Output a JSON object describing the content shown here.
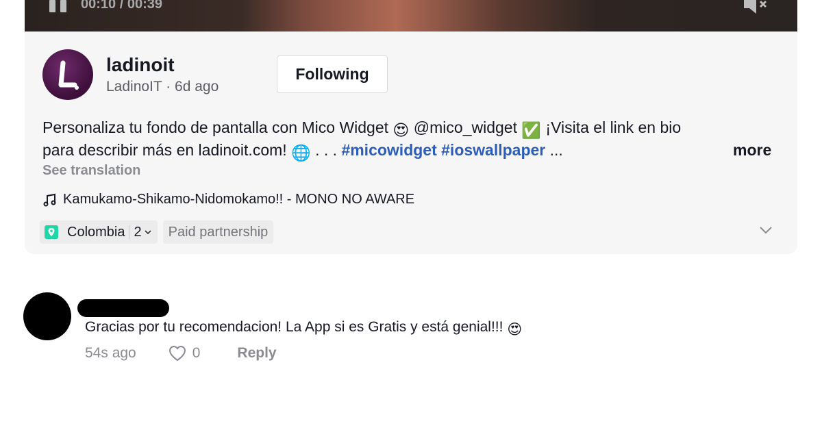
{
  "player": {
    "time": "00:10 / 00:39",
    "pause_icon": "pause-icon",
    "mute_icon": "muted-speaker-icon"
  },
  "post": {
    "username": "ladinoit",
    "display_name": "LadinoIT",
    "separator": " · ",
    "posted": "6d ago",
    "follow_label": "Following",
    "description": {
      "line1_text": "Personaliza tu fondo de pantalla con Mico Widget ",
      "emoji1": "😍",
      "mention": " @mico_widget ",
      "emoji2": "✅",
      "line1_end": " ¡Visita el link en bio",
      "line2_text": "para describir más en ladinoit.com! ",
      "emoji3": "🌐",
      "dots": " . . . ",
      "hashtag1": "#micowidget",
      "hashtag2": "#ioswallpaper",
      "ellipsis": " ..."
    },
    "more_label": "more",
    "see_translation": "See translation",
    "music": "Kamukamo-Shikamo-Nidomokamo!! - MONO NO AWARE",
    "location": "Colombia",
    "location_count": "2",
    "paid_label": "Paid partnership",
    "colors": {
      "hashtag": "#2b5db9",
      "card_bg": "#f6f6f6",
      "location_pin": "#20d5a8",
      "avatar": "#4a1347"
    }
  },
  "comment": {
    "text": "Gracias por tu recomendacion! La App si es Gratis y está genial!!! ",
    "emoji": "😍",
    "time": "54s ago",
    "likes": "0",
    "reply_label": "Reply"
  }
}
